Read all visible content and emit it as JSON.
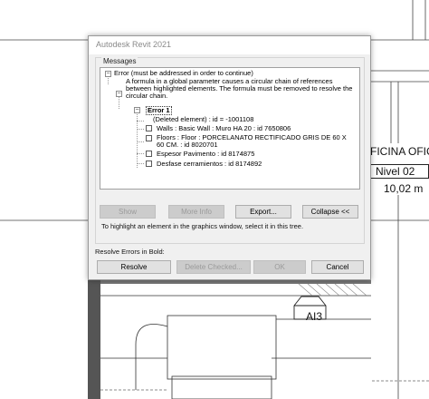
{
  "cad": {
    "room_name": "FICINA OFIC",
    "level": "Nivel 02",
    "height": "10,02 m",
    "tag": "AI3"
  },
  "dialog": {
    "title": "Autodesk Revit 2021",
    "messages_label": "Messages",
    "tree": {
      "root": "Error (must be addressed in order to continue)",
      "description": "A formula in a global parameter causes a circular chain of references between highlighted elements.  The formula must be removed to resolve the circular chain.",
      "error_label": "Error 1",
      "deleted_element": "(Deleted element) : id = -1001108",
      "items": [
        "Walls : Basic Wall : Muro HA 20 : id 7650806",
        "Floors : Floor : PORCELANATO RECTIFICADO GRIS DE 60 X 60 CM. : id 8020701",
        "Espesor Pavimento : id 8174875",
        "Desfase cerramientos : id 8174892"
      ]
    },
    "buttons": {
      "show": "Show",
      "more_info": "More Info",
      "export": "Export...",
      "collapse": "Collapse <<"
    },
    "hint": "To highlight an element in the graphics window, select it in this tree.",
    "resolve_label": "Resolve Errors in Bold:",
    "bottom_buttons": {
      "resolve": "Resolve",
      "delete_checked": "Delete Checked...",
      "ok": "OK",
      "cancel": "Cancel"
    }
  }
}
